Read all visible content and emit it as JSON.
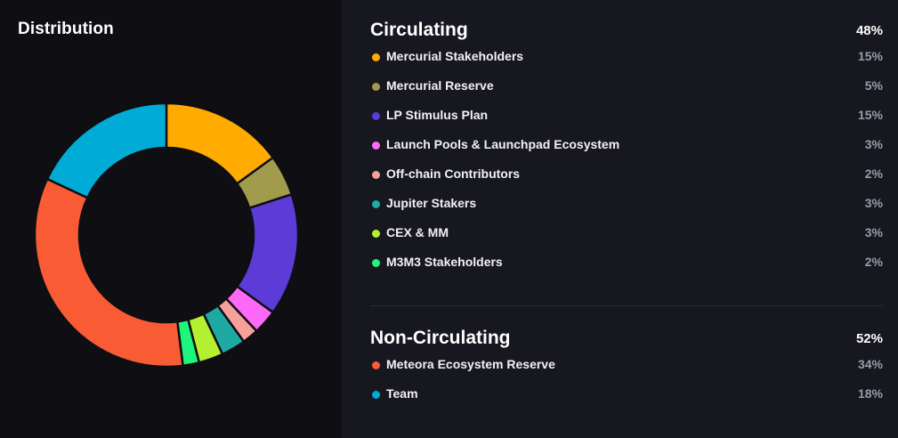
{
  "title": "Distribution",
  "colors": {
    "background_left": "#0e0e13",
    "background_right": "#17171f",
    "divider": "#2c2c38",
    "slice_border": "#0e0e13"
  },
  "chart_data": {
    "type": "pie",
    "donut": true,
    "title": "Distribution",
    "categories": [
      "Mercurial Stakeholders",
      "Mercurial Reserve",
      "LP Stimulus Plan",
      "Launch Pools & Launchpad Ecosystem",
      "Off-chain Contributors",
      "Jupiter Stakers",
      "CEX & MM",
      "M3M3 Stakeholders",
      "Meteora Ecosystem Reserve",
      "Team"
    ],
    "values": [
      15,
      5,
      15,
      3,
      2,
      3,
      3,
      2,
      34,
      18
    ],
    "unit": "%",
    "colors": [
      "#ffab00",
      "#a19c4d",
      "#5c3bd6",
      "#fe6af7",
      "#f7a09b",
      "#1eaaa3",
      "#b4f031",
      "#1ef57c",
      "#f95c35",
      "#00abd6"
    ],
    "legend": "right"
  },
  "sections": [
    {
      "title": "Circulating",
      "total": "48%",
      "items": [
        {
          "label": "Mercurial Stakeholders",
          "value": "15%",
          "color": "#ffab00"
        },
        {
          "label": "Mercurial Reserve",
          "value": "5%",
          "color": "#a19c4d"
        },
        {
          "label": "LP Stimulus Plan",
          "value": "15%",
          "color": "#5c3bd6"
        },
        {
          "label": "Launch Pools & Launchpad Ecosystem",
          "value": "3%",
          "color": "#fe6af7"
        },
        {
          "label": "Off-chain Contributors",
          "value": "2%",
          "color": "#f7a09b"
        },
        {
          "label": "Jupiter Stakers",
          "value": "3%",
          "color": "#1eaaa3"
        },
        {
          "label": "CEX & MM",
          "value": "3%",
          "color": "#b4f031"
        },
        {
          "label": "M3M3 Stakeholders",
          "value": "2%",
          "color": "#1ef57c"
        }
      ]
    },
    {
      "title": "Non-Circulating",
      "total": "52%",
      "items": [
        {
          "label": "Meteora Ecosystem Reserve",
          "value": "34%",
          "color": "#f95c35"
        },
        {
          "label": "Team",
          "value": "18%",
          "color": "#00abd6"
        }
      ]
    }
  ]
}
